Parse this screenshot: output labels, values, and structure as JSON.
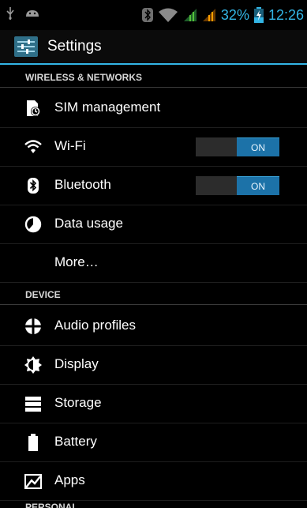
{
  "status_bar": {
    "battery_percent": "32%",
    "time": "12:26",
    "icons": [
      "usb-icon",
      "android-debug-icon",
      "bluetooth-icon",
      "wifi-icon",
      "signal-sim1-icon",
      "signal-sim2-icon",
      "battery-icon"
    ],
    "accent_color": "#33b5e5"
  },
  "action_bar": {
    "title": "Settings",
    "icon": "settings-app-icon"
  },
  "sections": {
    "wireless": "WIRELESS & NETWORKS",
    "device": "DEVICE",
    "personal": "PERSONAL"
  },
  "items": {
    "sim": {
      "label": "SIM management",
      "icon": "sim-card-icon"
    },
    "wifi": {
      "label": "Wi-Fi",
      "icon": "wifi-icon",
      "toggle": "ON"
    },
    "bluetooth": {
      "label": "Bluetooth",
      "icon": "bluetooth-icon",
      "toggle": "ON"
    },
    "data": {
      "label": "Data usage",
      "icon": "data-usage-icon"
    },
    "more": {
      "label": "More…"
    },
    "audio": {
      "label": "Audio profiles",
      "icon": "audio-profiles-icon"
    },
    "display": {
      "label": "Display",
      "icon": "display-icon"
    },
    "storage": {
      "label": "Storage",
      "icon": "storage-icon"
    },
    "battery": {
      "label": "Battery",
      "icon": "battery-icon"
    },
    "apps": {
      "label": "Apps",
      "icon": "apps-icon"
    }
  }
}
